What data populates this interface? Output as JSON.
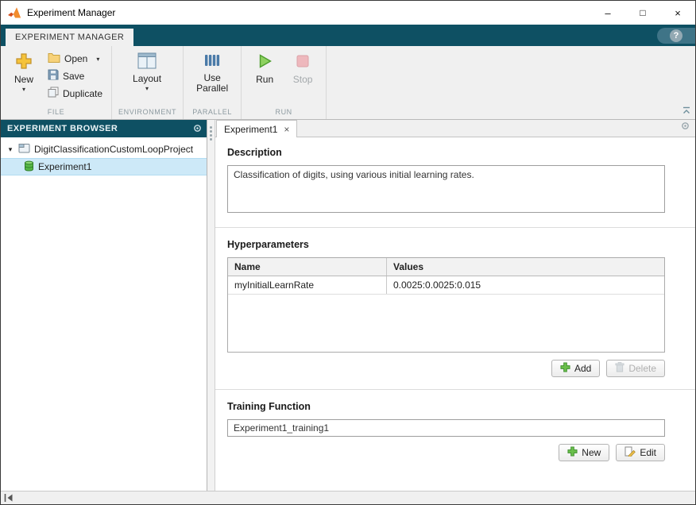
{
  "titlebar": {
    "title": "Experiment Manager",
    "minimize_glyph": "–",
    "maximize_glyph": "□",
    "close_glyph": "×"
  },
  "ribbon": {
    "tab_label": "EXPERIMENT MANAGER",
    "help_glyph": "?",
    "caret_glyph": "▾",
    "file_group": {
      "label": "FILE",
      "new_label": "New",
      "open_label": "Open",
      "save_label": "Save",
      "duplicate_label": "Duplicate"
    },
    "environment_group": {
      "label": "ENVIRONMENT",
      "layout_label": "Layout"
    },
    "parallel_group": {
      "label": "PARALLEL",
      "use_line1": "Use",
      "use_line2": "Parallel"
    },
    "run_group": {
      "label": "RUN",
      "run_label": "Run",
      "stop_label": "Stop"
    }
  },
  "browser": {
    "header": "EXPERIMENT BROWSER",
    "tree": {
      "caret_glyph": "▾",
      "project_label": "DigitClassificationCustomLoopProject",
      "experiment_label": "Experiment1"
    }
  },
  "document": {
    "tab_label": "Experiment1",
    "tab_close_glyph": "×",
    "description": {
      "heading": "Description",
      "text": "Classification of digits, using various initial learning rates."
    },
    "hyperparameters": {
      "heading": "Hyperparameters",
      "col_name": "Name",
      "col_values": "Values",
      "rows": [
        {
          "name": "myInitialLearnRate",
          "values": "0.0025:0.0025:0.015"
        }
      ],
      "add_label": "Add",
      "delete_label": "Delete"
    },
    "training": {
      "heading": "Training Function",
      "value": "Experiment1_training1",
      "new_label": "New",
      "edit_label": "Edit"
    }
  },
  "colors": {
    "accent_dark_teal": "#0e5063",
    "toolbar_bg": "#f0f0f0",
    "selection_blue": "#cde9f8",
    "run_green": "#6abf4b",
    "stop_pink": "#eeb8bd",
    "new_gold": "#f5c33b"
  }
}
